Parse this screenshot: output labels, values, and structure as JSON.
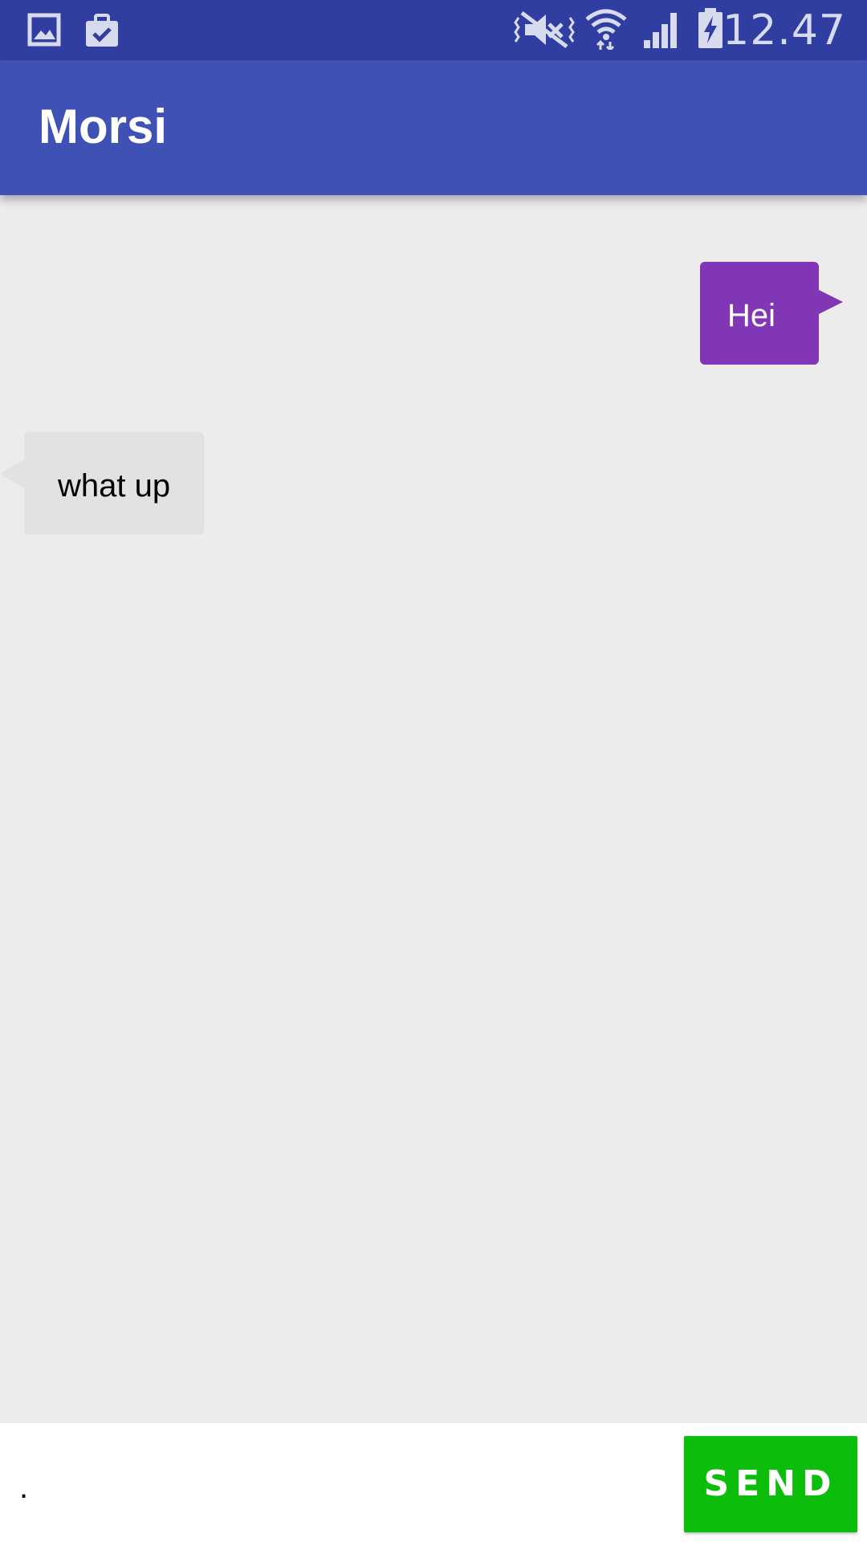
{
  "status_bar": {
    "time": "12.47",
    "icons": [
      "gallery-icon",
      "clipboard-check-icon",
      "vibrate-mute-icon",
      "wifi-icon",
      "cell-signal-icon",
      "battery-charging-icon"
    ]
  },
  "app_bar": {
    "title": "Morsi"
  },
  "messages": [
    {
      "direction": "outgoing",
      "text": "Hei"
    },
    {
      "direction": "incoming",
      "text": "what up"
    }
  ],
  "composer": {
    "input_value": ".",
    "send_label": "SEND"
  },
  "colors": {
    "status_bar": "#2f3ea0",
    "app_bar": "#3f51b5",
    "outgoing_bubble": "#8136b6",
    "incoming_bubble": "#e2e1e3",
    "chat_background": "#edeced",
    "send_button": "#0dbd0c"
  }
}
